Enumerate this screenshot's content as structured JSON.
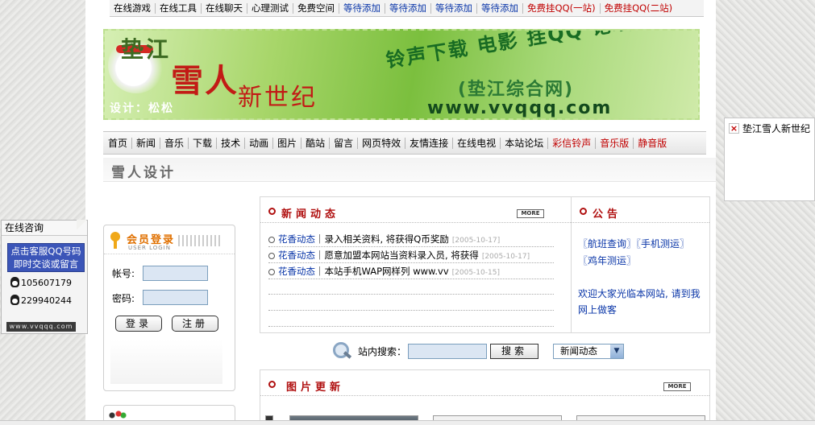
{
  "top_nav": [
    {
      "label": "在线游戏",
      "color": "black"
    },
    {
      "label": "在线工具",
      "color": "black"
    },
    {
      "label": "在线聊天",
      "color": "black"
    },
    {
      "label": "心理测试",
      "color": "black"
    },
    {
      "label": "免费空间",
      "color": "black"
    },
    {
      "label": "等待添加",
      "color": "blue"
    },
    {
      "label": "等待添加",
      "color": "blue"
    },
    {
      "label": "等待添加",
      "color": "blue"
    },
    {
      "label": "等待添加",
      "color": "blue"
    },
    {
      "label": "免费挂QQ(一站)",
      "color": "red"
    },
    {
      "label": "免费挂QQ(二站)",
      "color": "red"
    }
  ],
  "banner": {
    "name_small": "垫江",
    "name_big": "雪人",
    "subtitle": "新世纪",
    "designer": "设计：松松",
    "slogan": "铃声下载 电影 挂QQ 论坛",
    "site_name": "(垫江综合网)",
    "url": "www.vvqqq.com"
  },
  "main_nav": [
    {
      "label": "首页",
      "color": "black"
    },
    {
      "label": "新闻",
      "color": "black"
    },
    {
      "label": "音乐",
      "color": "black"
    },
    {
      "label": "下载",
      "color": "black"
    },
    {
      "label": "技术",
      "color": "black"
    },
    {
      "label": "动画",
      "color": "black"
    },
    {
      "label": "图片",
      "color": "black"
    },
    {
      "label": "酷站",
      "color": "black"
    },
    {
      "label": "留言",
      "color": "black"
    },
    {
      "label": "网页特效",
      "color": "black"
    },
    {
      "label": "友情连接",
      "color": "black"
    },
    {
      "label": "在线电视",
      "color": "black"
    },
    {
      "label": "本站论坛",
      "color": "black"
    },
    {
      "label": "彩信铃声",
      "color": "red"
    },
    {
      "label": "音乐版",
      "color": "red"
    },
    {
      "label": "静音版",
      "color": "red"
    }
  ],
  "design_label": "雪人设计",
  "login": {
    "title": "会员登录",
    "subtitle": "USER LOGIN",
    "account_label": "帐号:",
    "password_label": "密码:",
    "account_value": "",
    "password_value": "",
    "login_button": "登录",
    "register_button": "注册"
  },
  "news": {
    "title": "新闻动态",
    "more": "MORE",
    "items": [
      {
        "category": "花香动态",
        "title": "录入相关资料, 将获得Q币奖励",
        "date": "[2005-10-17]"
      },
      {
        "category": "花香动态",
        "title": "愿意加盟本网站当资料录入员, 将获得",
        "date": "[2005-10-17]"
      },
      {
        "category": "花香动态",
        "title": "本站手机WAP网样列 www.vv",
        "date": "[2005-10-15]"
      }
    ]
  },
  "notice": {
    "title": "公告",
    "lines": [
      "〖航班查询〗〖手机测运〗",
      "〖鸡年测运〗"
    ],
    "welcome": "欢迎大家光临本网站, 请到我网上做客"
  },
  "search": {
    "label": "站内搜索：",
    "value": "",
    "button": "搜索",
    "selected": "新闻动态"
  },
  "pictures": {
    "title": "图片更新",
    "more": "MORE"
  },
  "advisor": {
    "title": "在线咨询",
    "prompt": "点击客服QQ号码即时交谈或留言",
    "qq_numbers": [
      "105607179",
      "229940244"
    ],
    "url": "www.vvqqq.com"
  },
  "float_ad": {
    "close": "×",
    "text": "垫江雪人新世纪"
  }
}
